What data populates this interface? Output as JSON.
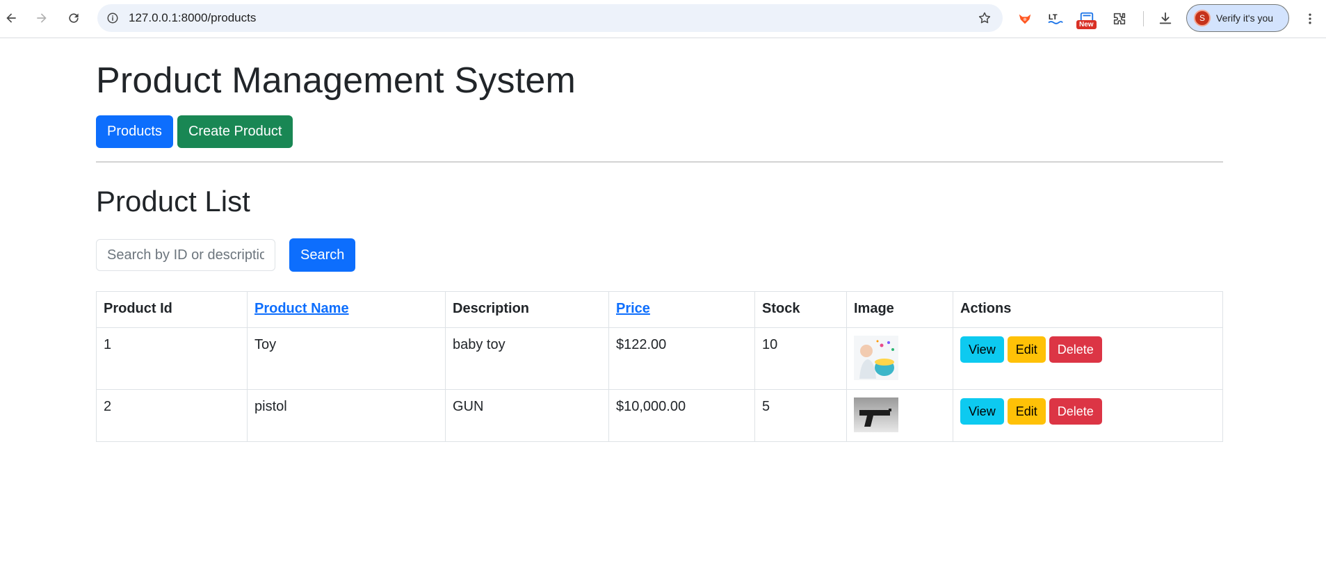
{
  "browser": {
    "url": "127.0.0.1:8000/products",
    "extension_badge": "New",
    "profile_initial": "S",
    "profile_label": "Verify it's you"
  },
  "page": {
    "title": "Product Management System",
    "nav": {
      "products_label": "Products",
      "create_label": "Create Product"
    },
    "list_title": "Product List",
    "search": {
      "placeholder": "Search by ID or description",
      "value": "",
      "button_label": "Search"
    }
  },
  "table": {
    "headers": {
      "id": "Product Id",
      "name": "Product Name",
      "description": "Description",
      "price": "Price",
      "stock": "Stock",
      "image": "Image",
      "actions": "Actions"
    },
    "rows": [
      {
        "id": "1",
        "name": "Toy",
        "description": "baby toy",
        "price": "$122.00",
        "stock": "10",
        "image_icon": "baby-toy-photo"
      },
      {
        "id": "2",
        "name": "pistol",
        "description": "GUN",
        "price": "$10,000.00",
        "stock": "5",
        "image_icon": "pistol-photo"
      }
    ],
    "action_labels": {
      "view": "View",
      "edit": "Edit",
      "delete": "Delete"
    }
  },
  "colors": {
    "primary": "#0d6efd",
    "success": "#198754",
    "info": "#0dcaf0",
    "warning": "#ffc107",
    "danger": "#dc3545"
  }
}
